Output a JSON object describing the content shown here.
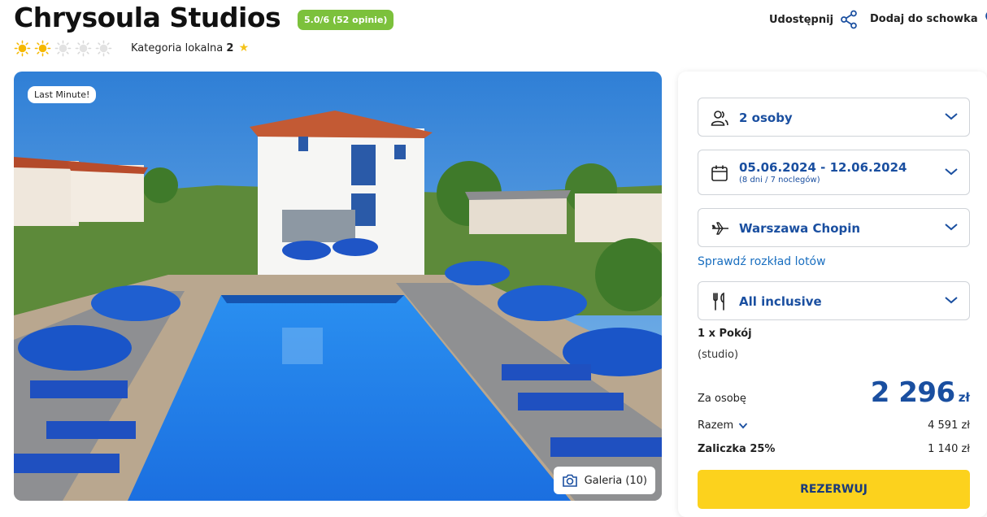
{
  "hotel": {
    "name": "Chrysoula Studios",
    "rating": "5.0/6 (52 opinie)",
    "suns_filled": 2,
    "suns_total": 5,
    "category_label": "Kategoria lokalna",
    "category_value": "2"
  },
  "actions": {
    "share_label": "Udostępnij",
    "wishlist_label": "Dodaj do schowka"
  },
  "photo": {
    "badge": "Last Minute!",
    "gallery_label": "Galeria (10)"
  },
  "booking": {
    "persons": "2 osoby",
    "dates": "05.06.2024 - 12.06.2024",
    "dates_sub": "(8 dni / 7 noclegów)",
    "departure": "Warszawa Chopin",
    "flight_link": "Sprawdź rozkład lotów",
    "board": "All inclusive",
    "room_count": "1 x Pokój",
    "room_type": "(studio)",
    "per_person_label": "Za osobę",
    "per_person_price": "2 296",
    "currency": "zł",
    "total_label": "Razem",
    "total_value": "4 591 zł",
    "deposit_label": "Zaliczka 25%",
    "deposit_value": "1 140 zł",
    "reserve_label": "REZERWUJ"
  },
  "colors": {
    "accent_blue": "#1a4fa0",
    "link_blue": "#1a6fc0",
    "rating_green": "#7cc13c",
    "reserve_yellow": "#fcd21d",
    "sun_filled": "#f5b800",
    "sun_empty": "#d8d8d8"
  },
  "icons": {
    "share": "share-icon",
    "wishlist": "heart-icon",
    "gallery": "camera-icon",
    "persons": "users-icon",
    "dates": "calendar-icon",
    "departure": "plane-icon",
    "board": "cutlery-icon",
    "dropdown": "chevron-down-icon"
  }
}
